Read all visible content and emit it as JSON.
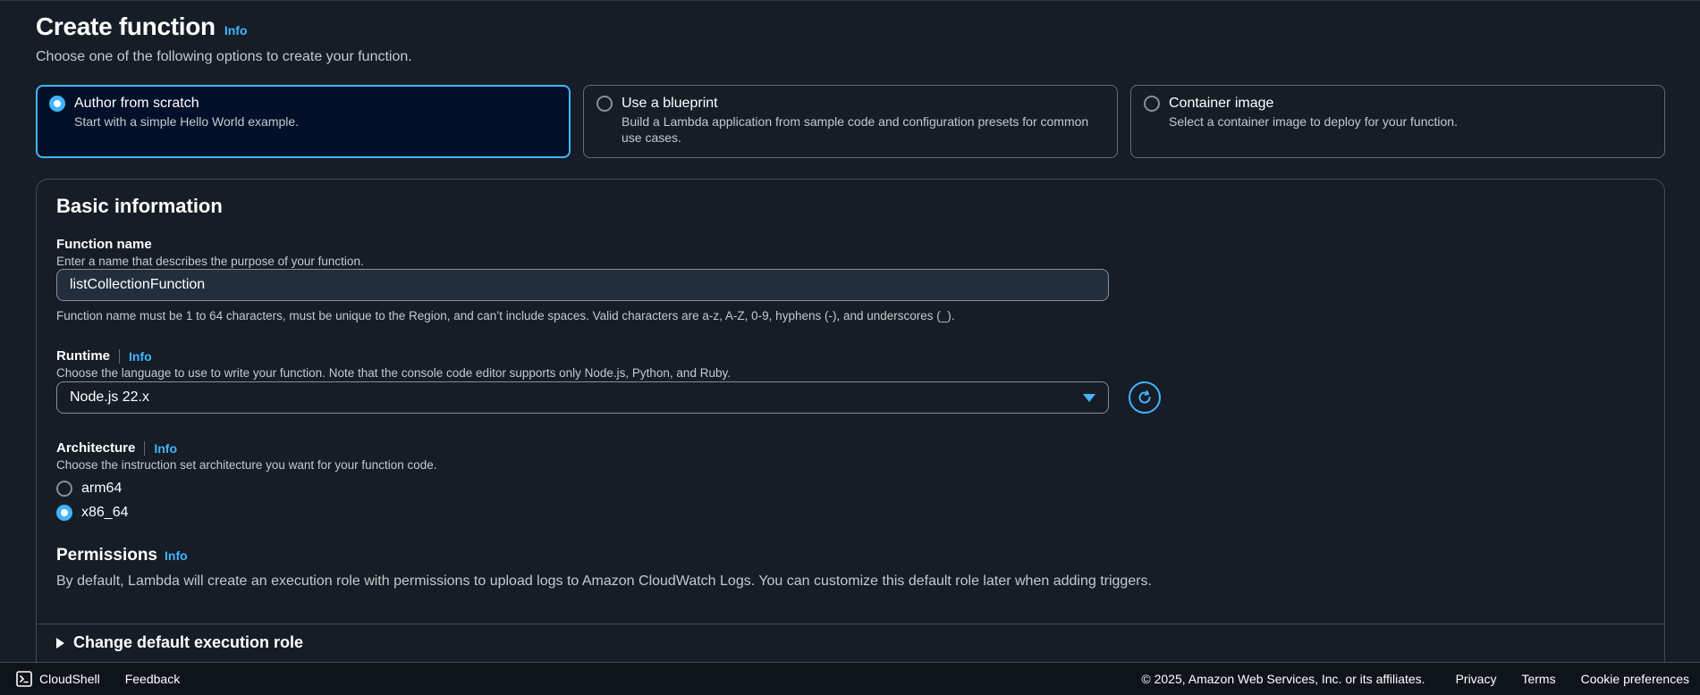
{
  "header": {
    "title": "Create function",
    "info_label": "Info",
    "subtitle": "Choose one of the following options to create your function."
  },
  "options": [
    {
      "title": "Author from scratch",
      "description": "Start with a simple Hello World example.",
      "selected": true
    },
    {
      "title": "Use a blueprint",
      "description": "Build a Lambda application from sample code and configuration presets for common use cases.",
      "selected": false
    },
    {
      "title": "Container image",
      "description": "Select a container image to deploy for your function.",
      "selected": false
    }
  ],
  "basic_info": {
    "title": "Basic information",
    "function_name": {
      "label": "Function name",
      "description": "Enter a name that describes the purpose of your function.",
      "value": "listCollectionFunction",
      "constraint": "Function name must be 1 to 64 characters, must be unique to the Region, and can’t include spaces. Valid characters are a-z, A-Z, 0-9, hyphens (-), and underscores (_)."
    },
    "runtime": {
      "label": "Runtime",
      "info_label": "Info",
      "description": "Choose the language to use to write your function. Note that the console code editor supports only Node.js, Python, and Ruby.",
      "selected": "Node.js 22.x"
    },
    "architecture": {
      "label": "Architecture",
      "info_label": "Info",
      "description": "Choose the instruction set architecture you want for your function code.",
      "options": [
        {
          "label": "arm64",
          "selected": false
        },
        {
          "label": "x86_64",
          "selected": true
        }
      ]
    },
    "permissions": {
      "title": "Permissions",
      "info_label": "Info",
      "description": "By default, Lambda will create an execution role with permissions to upload logs to Amazon CloudWatch Logs. You can customize this default role later when adding triggers."
    },
    "change_role": {
      "label": "Change default execution role"
    }
  },
  "footer": {
    "cloudshell": "CloudShell",
    "feedback": "Feedback",
    "copyright": "© 2025, Amazon Web Services, Inc. or its affiliates.",
    "privacy": "Privacy",
    "terms": "Terms",
    "cookie_preferences": "Cookie preferences"
  },
  "colors": {
    "accent": "#42b4ff",
    "background": "#161d26",
    "selected_tile_bg": "#001129"
  }
}
